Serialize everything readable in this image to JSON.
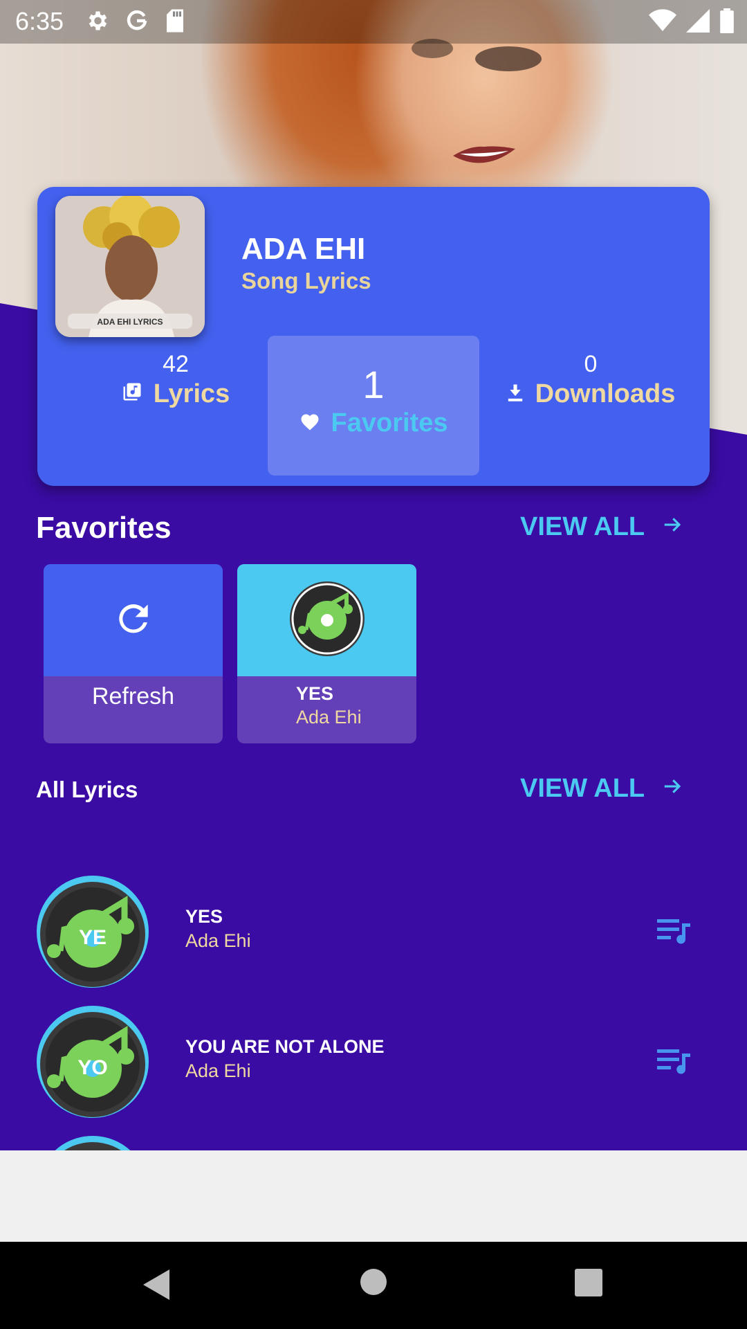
{
  "status_bar": {
    "time": "6:35"
  },
  "header": {
    "artist_name": "ADA EHI",
    "subtitle": "Song Lyrics",
    "cover_caption": "ADA EHI LYRICS"
  },
  "stats": {
    "lyrics": {
      "count": "42",
      "label": "Lyrics"
    },
    "favorites": {
      "count": "1",
      "label": "Favorites"
    },
    "downloads": {
      "count": "0",
      "label": "Downloads"
    }
  },
  "favorites_section": {
    "title": "Favorites",
    "view_all": "VIEW ALL",
    "refresh_label": "Refresh",
    "items": [
      {
        "title": "YES",
        "artist": "Ada Ehi"
      }
    ]
  },
  "all_lyrics_section": {
    "title": "All Lyrics",
    "view_all": "VIEW ALL",
    "items": [
      {
        "badge": "YE",
        "title": "YES",
        "artist": "Ada Ehi"
      },
      {
        "badge": "YO",
        "title": "YOU ARE NOT ALONE",
        "artist": "Ada Ehi"
      }
    ]
  },
  "colors": {
    "background": "#3a0ca3",
    "card": "#4361ee",
    "accent_cyan": "#4cc9f0",
    "accent_gold": "#f0d9a0",
    "tile_bottom": "#6440b8"
  },
  "icons": [
    "settings-icon",
    "google-icon",
    "sdcard-icon",
    "wifi-icon",
    "signal-icon",
    "battery-icon",
    "music-library-icon",
    "heart-icon",
    "download-icon",
    "arrow-right-icon",
    "refresh-icon",
    "music-disc-icon",
    "playlist-add-icon",
    "nav-back-icon",
    "nav-home-icon",
    "nav-recents-icon"
  ]
}
